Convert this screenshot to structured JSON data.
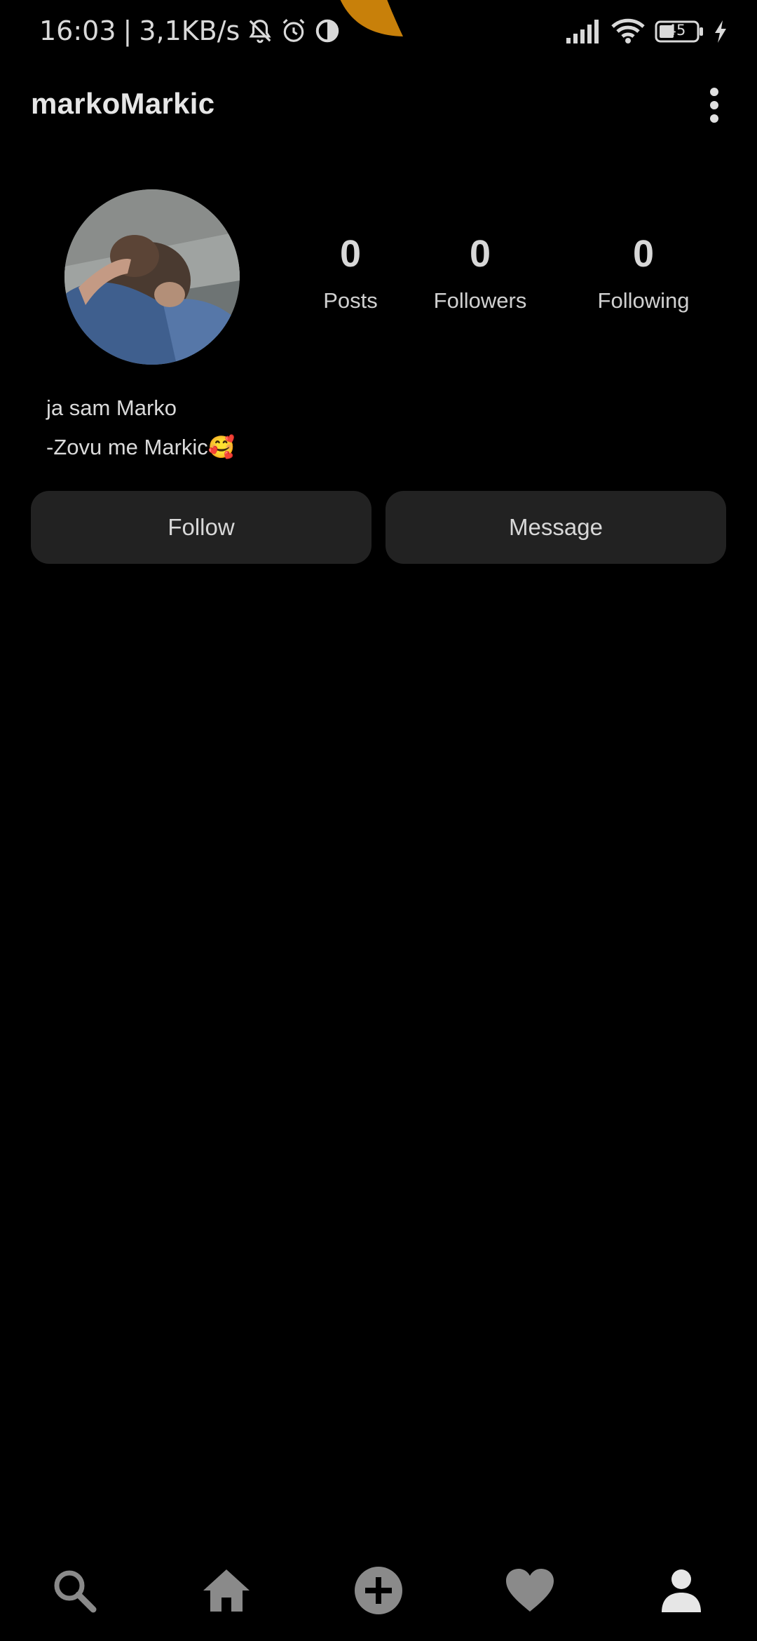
{
  "status_bar": {
    "time": "16:03",
    "separator": "|",
    "network_speed": "3,1KB/s",
    "battery_level": "45",
    "icons": [
      "bell-off-icon",
      "alarm-icon",
      "data-saver-icon",
      "signal-icon",
      "wifi-icon",
      "battery-icon",
      "charging-icon"
    ]
  },
  "header": {
    "username": "markoMarkic",
    "menu_icon": "more-vertical-icon"
  },
  "profile": {
    "avatar_icon": "profile-photo",
    "stats": [
      {
        "count": "0",
        "label": "Posts"
      },
      {
        "count": "0",
        "label": "Followers"
      },
      {
        "count": "0",
        "label": "Following"
      }
    ],
    "bio_lines": [
      "ja sam Marko",
      "-Zovu me Markic🥰"
    ]
  },
  "actions": {
    "follow_label": "Follow",
    "message_label": "Message"
  },
  "bottom_nav": {
    "items": [
      "search-icon",
      "home-icon",
      "add-circle-icon",
      "heart-icon",
      "profile-icon"
    ],
    "active": "profile-icon"
  },
  "colors": {
    "background": "#000000",
    "button_bg": "#222222",
    "text": "#d8d8d8",
    "nav_inactive": "#8a8a8a",
    "nav_active": "#e6e6e6",
    "camera_blob": "#c8800a"
  }
}
